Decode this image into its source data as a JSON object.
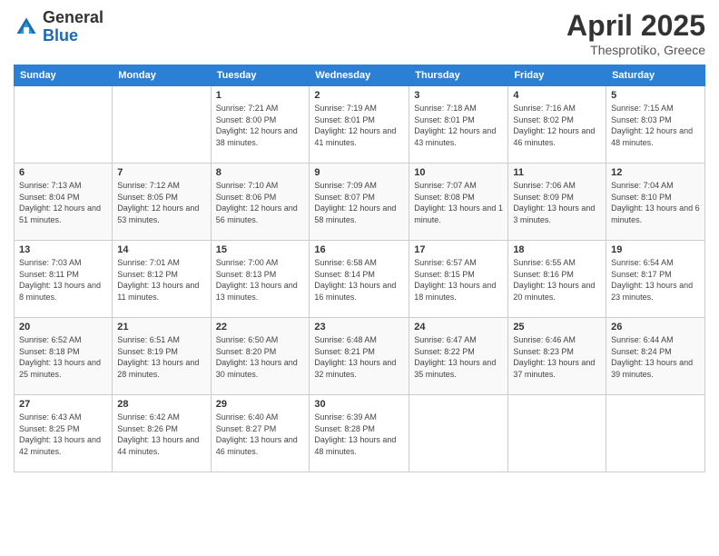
{
  "logo": {
    "general": "General",
    "blue": "Blue"
  },
  "header": {
    "title": "April 2025",
    "subtitle": "Thesprotiko, Greece"
  },
  "weekdays": [
    "Sunday",
    "Monday",
    "Tuesday",
    "Wednesday",
    "Thursday",
    "Friday",
    "Saturday"
  ],
  "weeks": [
    [
      null,
      null,
      {
        "day": "1",
        "sunrise": "7:21 AM",
        "sunset": "8:00 PM",
        "daylight": "12 hours and 38 minutes."
      },
      {
        "day": "2",
        "sunrise": "7:19 AM",
        "sunset": "8:01 PM",
        "daylight": "12 hours and 41 minutes."
      },
      {
        "day": "3",
        "sunrise": "7:18 AM",
        "sunset": "8:01 PM",
        "daylight": "12 hours and 43 minutes."
      },
      {
        "day": "4",
        "sunrise": "7:16 AM",
        "sunset": "8:02 PM",
        "daylight": "12 hours and 46 minutes."
      },
      {
        "day": "5",
        "sunrise": "7:15 AM",
        "sunset": "8:03 PM",
        "daylight": "12 hours and 48 minutes."
      }
    ],
    [
      {
        "day": "6",
        "sunrise": "7:13 AM",
        "sunset": "8:04 PM",
        "daylight": "12 hours and 51 minutes."
      },
      {
        "day": "7",
        "sunrise": "7:12 AM",
        "sunset": "8:05 PM",
        "daylight": "12 hours and 53 minutes."
      },
      {
        "day": "8",
        "sunrise": "7:10 AM",
        "sunset": "8:06 PM",
        "daylight": "12 hours and 56 minutes."
      },
      {
        "day": "9",
        "sunrise": "7:09 AM",
        "sunset": "8:07 PM",
        "daylight": "12 hours and 58 minutes."
      },
      {
        "day": "10",
        "sunrise": "7:07 AM",
        "sunset": "8:08 PM",
        "daylight": "13 hours and 1 minute."
      },
      {
        "day": "11",
        "sunrise": "7:06 AM",
        "sunset": "8:09 PM",
        "daylight": "13 hours and 3 minutes."
      },
      {
        "day": "12",
        "sunrise": "7:04 AM",
        "sunset": "8:10 PM",
        "daylight": "13 hours and 6 minutes."
      }
    ],
    [
      {
        "day": "13",
        "sunrise": "7:03 AM",
        "sunset": "8:11 PM",
        "daylight": "13 hours and 8 minutes."
      },
      {
        "day": "14",
        "sunrise": "7:01 AM",
        "sunset": "8:12 PM",
        "daylight": "13 hours and 11 minutes."
      },
      {
        "day": "15",
        "sunrise": "7:00 AM",
        "sunset": "8:13 PM",
        "daylight": "13 hours and 13 minutes."
      },
      {
        "day": "16",
        "sunrise": "6:58 AM",
        "sunset": "8:14 PM",
        "daylight": "13 hours and 16 minutes."
      },
      {
        "day": "17",
        "sunrise": "6:57 AM",
        "sunset": "8:15 PM",
        "daylight": "13 hours and 18 minutes."
      },
      {
        "day": "18",
        "sunrise": "6:55 AM",
        "sunset": "8:16 PM",
        "daylight": "13 hours and 20 minutes."
      },
      {
        "day": "19",
        "sunrise": "6:54 AM",
        "sunset": "8:17 PM",
        "daylight": "13 hours and 23 minutes."
      }
    ],
    [
      {
        "day": "20",
        "sunrise": "6:52 AM",
        "sunset": "8:18 PM",
        "daylight": "13 hours and 25 minutes."
      },
      {
        "day": "21",
        "sunrise": "6:51 AM",
        "sunset": "8:19 PM",
        "daylight": "13 hours and 28 minutes."
      },
      {
        "day": "22",
        "sunrise": "6:50 AM",
        "sunset": "8:20 PM",
        "daylight": "13 hours and 30 minutes."
      },
      {
        "day": "23",
        "sunrise": "6:48 AM",
        "sunset": "8:21 PM",
        "daylight": "13 hours and 32 minutes."
      },
      {
        "day": "24",
        "sunrise": "6:47 AM",
        "sunset": "8:22 PM",
        "daylight": "13 hours and 35 minutes."
      },
      {
        "day": "25",
        "sunrise": "6:46 AM",
        "sunset": "8:23 PM",
        "daylight": "13 hours and 37 minutes."
      },
      {
        "day": "26",
        "sunrise": "6:44 AM",
        "sunset": "8:24 PM",
        "daylight": "13 hours and 39 minutes."
      }
    ],
    [
      {
        "day": "27",
        "sunrise": "6:43 AM",
        "sunset": "8:25 PM",
        "daylight": "13 hours and 42 minutes."
      },
      {
        "day": "28",
        "sunrise": "6:42 AM",
        "sunset": "8:26 PM",
        "daylight": "13 hours and 44 minutes."
      },
      {
        "day": "29",
        "sunrise": "6:40 AM",
        "sunset": "8:27 PM",
        "daylight": "13 hours and 46 minutes."
      },
      {
        "day": "30",
        "sunrise": "6:39 AM",
        "sunset": "8:28 PM",
        "daylight": "13 hours and 48 minutes."
      },
      null,
      null,
      null
    ]
  ]
}
